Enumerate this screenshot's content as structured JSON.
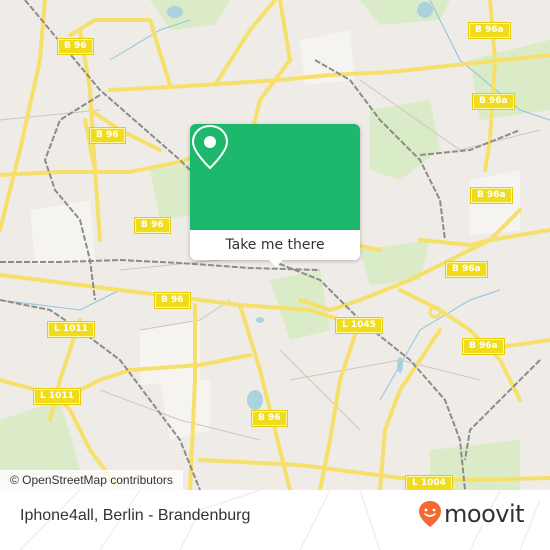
{
  "map": {
    "colors": {
      "background": "#efebe6",
      "major_road": "#f7e06a",
      "road_label_bg": "#f1dc1c",
      "rail": "#8c8c8c",
      "water": "#aad3df",
      "park": "#d8ebc4",
      "popup_green": "#1db86b",
      "moovit_orange": "#f26a32"
    },
    "road_labels": [
      {
        "id": "b96-1",
        "text": "B 96"
      },
      {
        "id": "b96-2",
        "text": "B 96"
      },
      {
        "id": "b96-3",
        "text": "B 96"
      },
      {
        "id": "b96-4",
        "text": "B 96"
      },
      {
        "id": "b96-5",
        "text": "B 96"
      },
      {
        "id": "b96a-1",
        "text": "B 96a"
      },
      {
        "id": "b96a-2",
        "text": "B 96a"
      },
      {
        "id": "b96a-3",
        "text": "B 96a"
      },
      {
        "id": "b96a-4",
        "text": "B 96a"
      },
      {
        "id": "b96a-5",
        "text": "B 96a"
      },
      {
        "id": "l1045",
        "text": "L 1045"
      },
      {
        "id": "l1011-1",
        "text": "L 1011"
      },
      {
        "id": "l1011-2",
        "text": "L 1011"
      },
      {
        "id": "l1004",
        "text": "L 1004"
      }
    ],
    "popup": {
      "icon": "map-pin-icon",
      "button_label": "Take me there"
    },
    "attribution": "© OpenStreetMap contributors"
  },
  "footer": {
    "place_name": "Iphone4all, Berlin - Brandenburg",
    "brand": "moovit",
    "brand_icon": "moovit-smile-pin-icon"
  }
}
